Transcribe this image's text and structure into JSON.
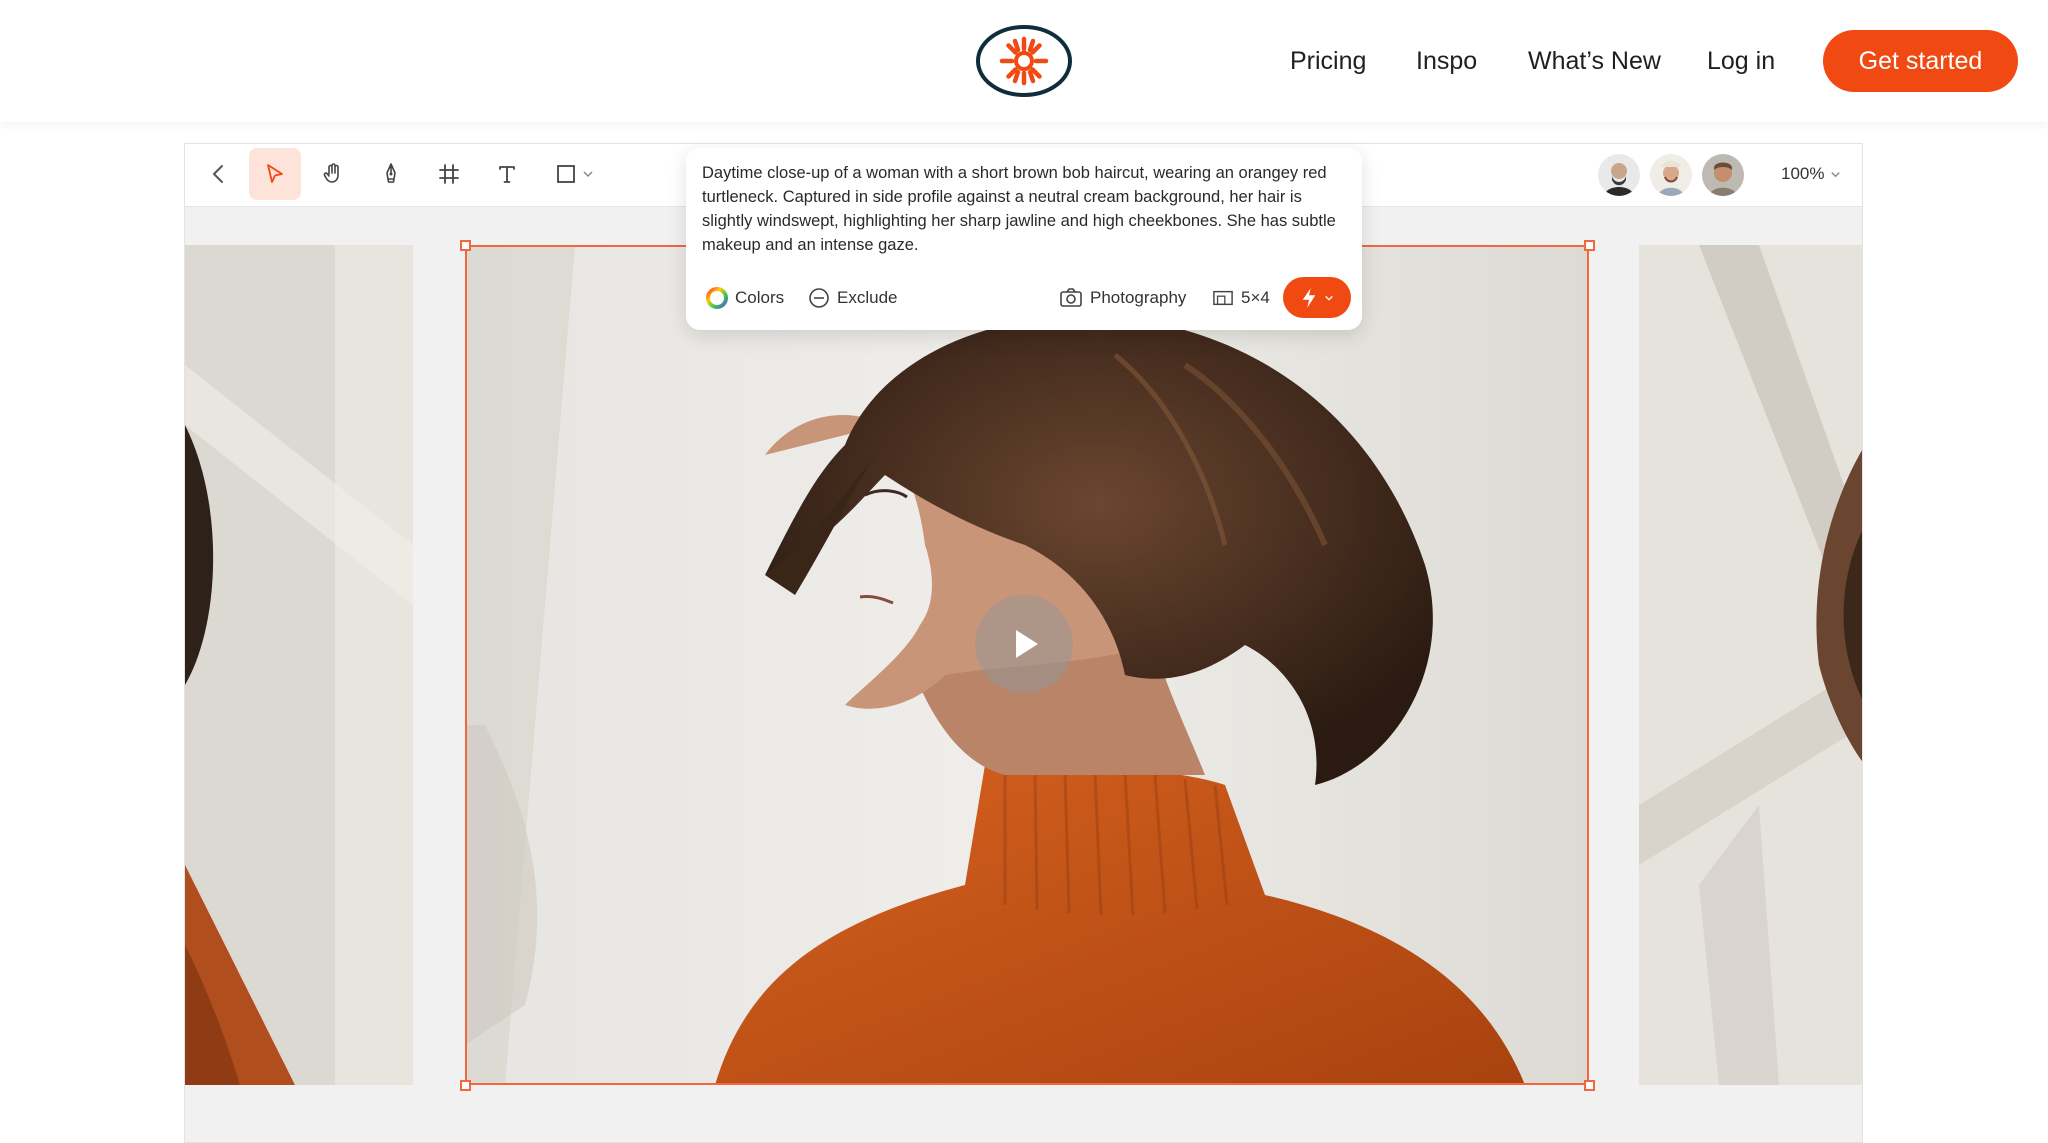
{
  "nav": {
    "links": [
      "Pricing",
      "Inspo",
      "What’s New",
      "Log in"
    ],
    "cta": "Get started"
  },
  "colors": {
    "accent": "#f04a12",
    "selection": "#f0683f",
    "logo_ring": "#0f2e3b",
    "sweater": "#c4531c"
  },
  "toolbar": {
    "icons": [
      "back-chevron-icon",
      "select-arrow-icon",
      "hand-icon",
      "pen-icon",
      "frame-grid-icon",
      "text-icon",
      "shape-square-icon"
    ],
    "zoom": "100%"
  },
  "prompt": {
    "text": "Daytime close-up of a woman with a short brown bob haircut, wearing an orangey red turtleneck. Captured in side profile against a neutral cream background, her hair is slightly windswept, highlighting her sharp jawline and high cheekbones. She has subtle makeup and an intense gaze.",
    "colors_label": "Colors",
    "exclude_label": "Exclude",
    "style_label": "Photography",
    "ratio_label": "5×4"
  }
}
